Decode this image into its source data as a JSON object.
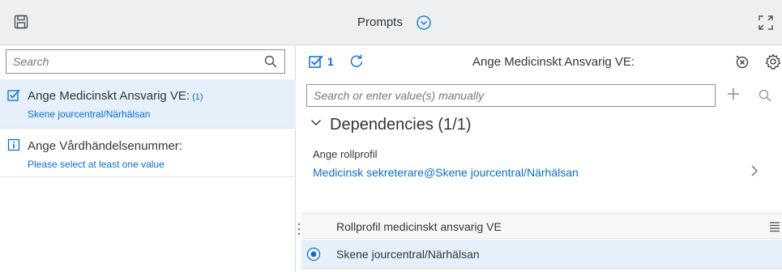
{
  "header": {
    "title": "Prompts"
  },
  "left_panel": {
    "search_placeholder": "Search",
    "items": [
      {
        "label": "Ange Medicinskt Ansvarig VE:",
        "count": "(1)",
        "value": "Skene jourcentral/Närhälsan",
        "state": "selected"
      },
      {
        "label": "Ange Vårdhändelsenummer:",
        "value": "Please select at least one value",
        "state": "info"
      }
    ]
  },
  "right_panel": {
    "selected_count": "1",
    "title": "Ange Medicinskt Ansvarig VE:",
    "search_placeholder": "Search or enter value(s) manually",
    "dependencies": {
      "heading": "Dependencies (1/1)",
      "label": "Ange rollprofil",
      "value": "Medicinsk sekreterare@Skene jourcentral/Närhälsan"
    },
    "table": {
      "column_header": "Rollprofil medicinskt ansvarig VE",
      "rows": [
        {
          "label": "Skene jourcentral/Närhälsan",
          "selected": true
        }
      ]
    }
  },
  "colors": {
    "accent": "#0a6ed1",
    "selected_bg": "#e5f0fa",
    "header_bg": "#edeff0"
  }
}
